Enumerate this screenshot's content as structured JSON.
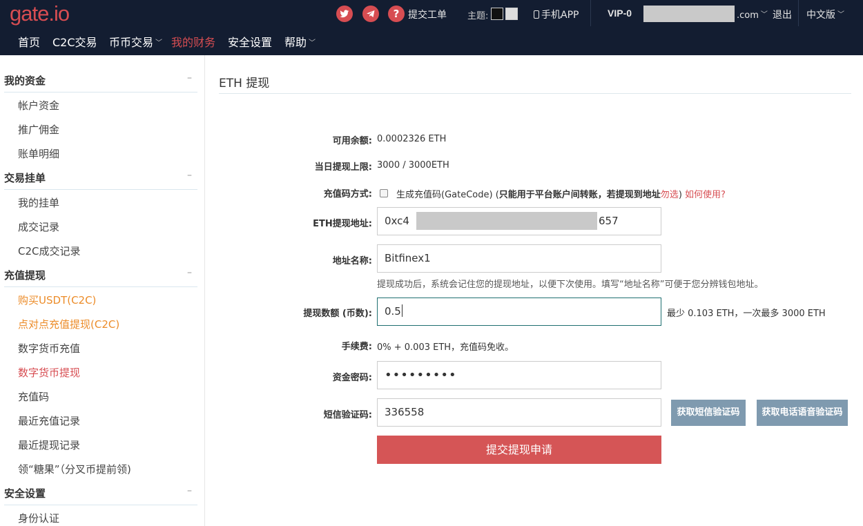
{
  "header": {
    "logo": "gate.io",
    "ticket_label": "提交工单",
    "theme_label": "主题:",
    "app_label": "手机APP",
    "vip": "VIP-0",
    "email_suffix": ".com",
    "logout": "退出",
    "language": "中文版",
    "help_glyph": "?"
  },
  "nav": {
    "items": [
      {
        "label": "首页"
      },
      {
        "label": "C2C交易"
      },
      {
        "label": "币币交易"
      },
      {
        "label": "我的财务",
        "active": true
      },
      {
        "label": "安全设置"
      },
      {
        "label": "帮助"
      }
    ]
  },
  "sidebar": {
    "groups": [
      {
        "title": "我的资金",
        "items": [
          "帐户资金",
          "推广佣金",
          "账单明细"
        ]
      },
      {
        "title": "交易挂单",
        "items": [
          "我的挂单",
          "成交记录",
          "C2C成交记录"
        ]
      },
      {
        "title": "充值提现",
        "items": [
          "购买USDT(C2C)",
          "点对点充值提现(C2C)",
          "数字货币充值",
          "数字货币提现",
          "充值码",
          "最近充值记录",
          "最近提现记录",
          "领“糖果”（分叉币提前领)"
        ]
      },
      {
        "title": "安全设置",
        "items": [
          "身份认证"
        ]
      }
    ],
    "collapse_glyph": "–"
  },
  "main": {
    "title": "ETH 提现",
    "available_label": "可用余额:",
    "available_value": "0.0002326 ETH",
    "daily_limit_label": "当日提现上限:",
    "daily_limit_value": "3000 / 3000ETH",
    "code_method_label": "充值码方式:",
    "code_text_a": "生成充值码",
    "code_text_b": "(GateCode) (",
    "code_text_c": "只能用于平台账户间转账，若提现到地址",
    "code_text_d": "勿选",
    "code_text_e": ")",
    "code_help": "如何使用?",
    "address_label": "ETH提现地址:",
    "address_prefix": "0xc4",
    "address_suffix": "657",
    "name_label": "地址名称:",
    "name_value": "Bitfinex1",
    "name_hint": "提现成功后，系统会记住您的提现地址，以便下次使用。填写“地址名称”可便于您分辨钱包地址。",
    "amount_label": "提现数额 (币数):",
    "amount_value": "0.5",
    "amount_note": "最少 0.103 ETH，一次最多 3000 ETH",
    "fee_label": "手续费:",
    "fee_value": "0% + 0.003 ETH，充值码免收。",
    "fund_pwd_label": "资金密码:",
    "fund_pwd_value": "•••••••••",
    "sms_label": "短信验证码:",
    "sms_value": "336558",
    "sms_button": "获取短信验证码",
    "voice_button": "获取电话语音验证码",
    "submit_button": "提交提现申请"
  },
  "colors": {
    "accent": "#d74d52",
    "header_bg": "#131d31",
    "orange": "#ec8c29",
    "gray_button": "#7f9aaf"
  }
}
